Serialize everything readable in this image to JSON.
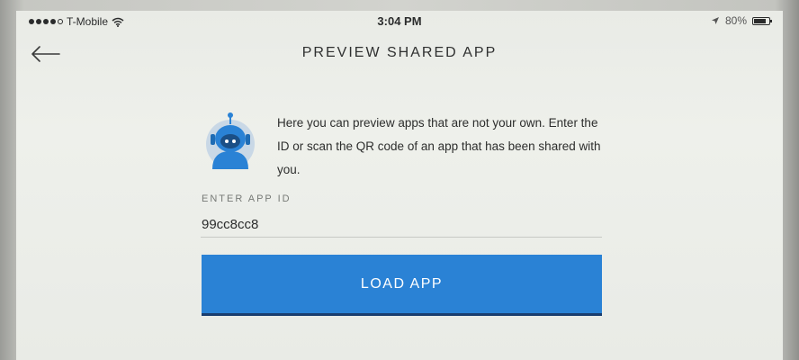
{
  "status_bar": {
    "carrier": "T-Mobile",
    "time": "3:04 PM",
    "battery": "80%",
    "battery_level": 0.8,
    "signal_bars": 4,
    "icons": [
      "wifi-icon",
      "location-arrow-icon",
      "battery-icon"
    ]
  },
  "nav": {
    "back_icon": "arrow-left-icon",
    "title": "PREVIEW SHARED APP"
  },
  "intro": {
    "avatar_icon": "robot-icon",
    "text": "Here you can preview apps that are not your own. Enter the ID or scan the QR code of an app that has been shared with you."
  },
  "form": {
    "label": "ENTER APP ID",
    "value": "99cc8cc8",
    "button_label": "LOAD APP"
  },
  "colors": {
    "accent": "#2a82d5",
    "background": "#eceee9"
  }
}
